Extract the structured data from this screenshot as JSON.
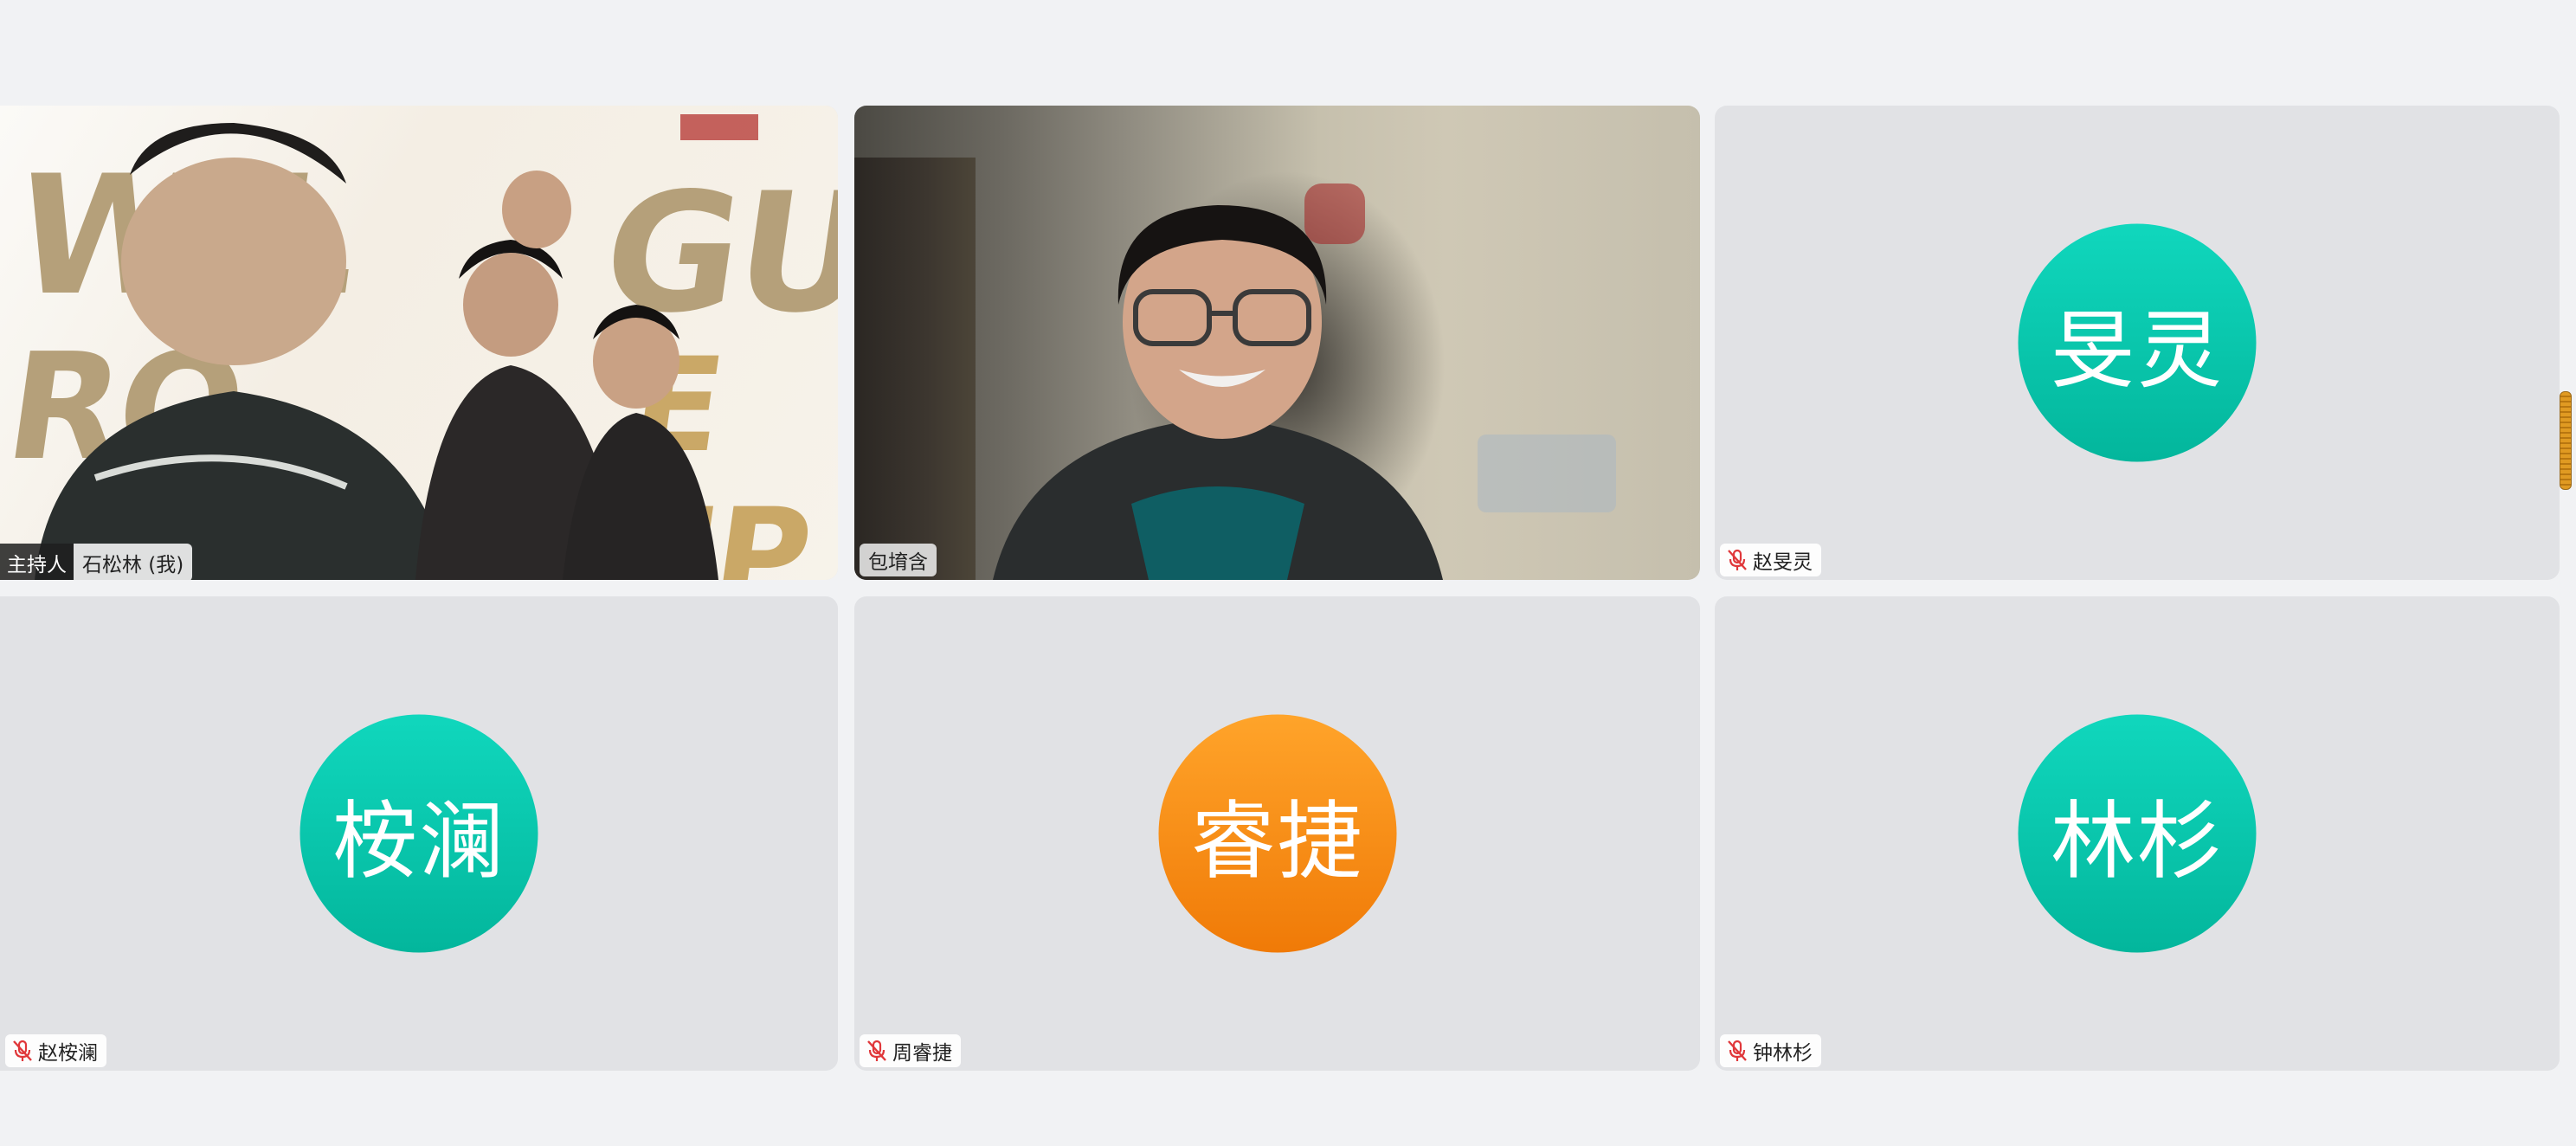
{
  "participants": [
    {
      "role_badge": "主持人",
      "name": "石松林 (我)",
      "has_video": true,
      "background_text": [
        "WIL",
        "RO",
        "GUE",
        "E UP"
      ]
    },
    {
      "name": "包堉含",
      "has_video": true
    },
    {
      "avatar_text": "旻灵",
      "name": "赵旻灵",
      "avatar_color": "#08c8ae",
      "muted": true
    },
    {
      "avatar_text": "桉澜",
      "name": "赵桉澜",
      "avatar_color": "#08c8ae",
      "muted": true
    },
    {
      "avatar_text": "睿捷",
      "name": "周睿捷",
      "avatar_color": "#f58d16",
      "muted": true
    },
    {
      "avatar_text": "林杉",
      "name": "钟林杉",
      "avatar_color": "#08c8ae",
      "muted": true
    }
  ],
  "icons": {
    "muted": "mic-off-icon"
  }
}
